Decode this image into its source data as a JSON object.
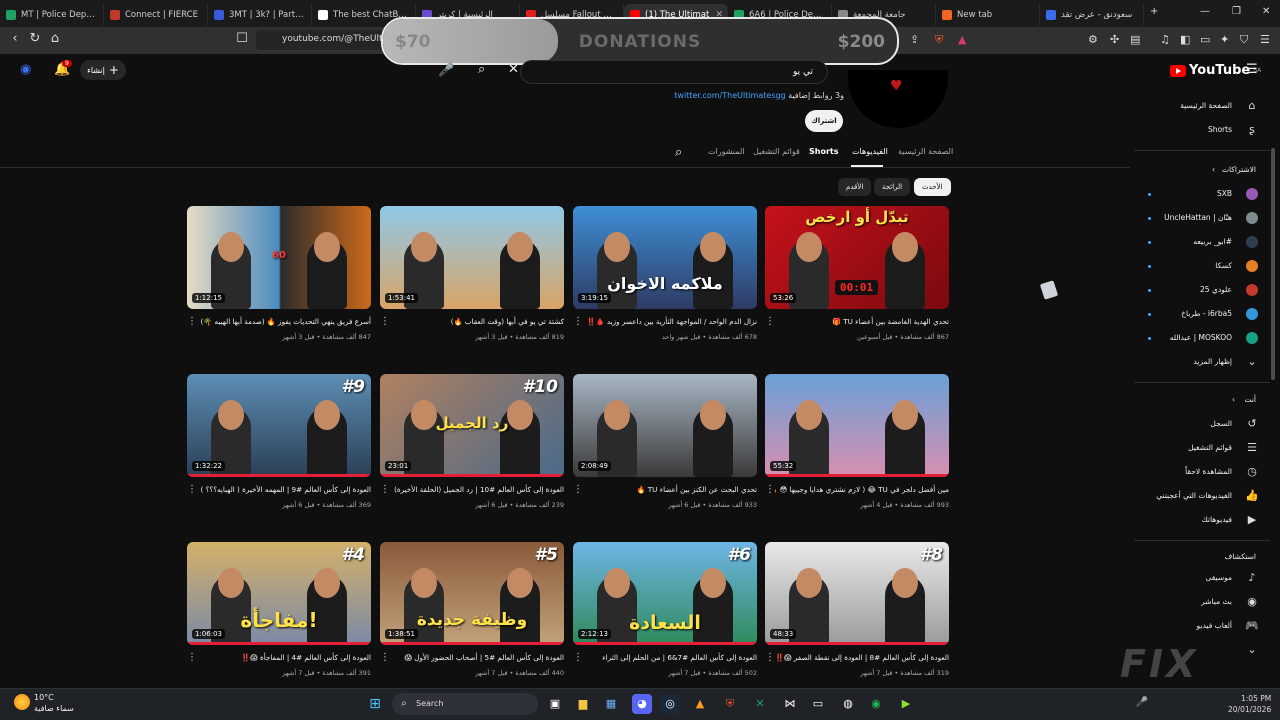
{
  "browser": {
    "tabs": [
      {
        "label": "MT | Police Departm",
        "color": "#1ea362"
      },
      {
        "label": "Connect | FIERCE",
        "color": "#c0392b"
      },
      {
        "label": "3MT | 3k? | Partner?",
        "color": "#3a5bd9"
      },
      {
        "label": "The best ChatBot a",
        "color": "#ffffff"
      },
      {
        "label": "الرئيسية | كريتر",
        "color": "#6a4cd3"
      },
      {
        "label": "مسلسل Fallout الموس",
        "color": "#e02020"
      },
      {
        "label": "(1) The Ultimat",
        "color": "#ff0000",
        "active": true
      },
      {
        "label": "6A6 | Police Depart",
        "color": "#1ea362"
      },
      {
        "label": "جامعة المجمعة",
        "color": "#888888"
      },
      {
        "label": "New tab",
        "color": "#f26522"
      },
      {
        "label": "سعودنق - عرض تقد",
        "color": "#3a6cf0"
      }
    ],
    "url": "youtube.com/@TheUltimateTU/videos",
    "url_prefix": "youtube.com/@TheUlti"
  },
  "donation": {
    "label": "DONATIONS",
    "min": "$70",
    "max": "$200",
    "progress": 0.34
  },
  "header": {
    "search_value": "تي يو",
    "create_label": "إنشاء",
    "logo_text": "YouTube",
    "logo_region": "SA",
    "notification_count": "9"
  },
  "channel": {
    "links_text": "twitter.com/TheUltimatesgg",
    "links_more": "و3 روابط إضافية",
    "subscribe_label": "اشتراك",
    "tabs": {
      "home": "الصفحة الرئيسية",
      "videos": "الفيديوهات",
      "shorts": "Shorts",
      "playlists": "قوائم التشغيل",
      "posts": "المنشورات"
    },
    "chips": {
      "latest": "الأحدث",
      "popular": "الرائجة",
      "oldest": "الأقدم"
    }
  },
  "videos": [
    {
      "title": "تحدي الهدية الغامضة بين أعضاء TU 🎁",
      "meta": "867 ألف مشاهدة • قبل أسبوعين",
      "duration": "53:26",
      "progress": 0.0
    },
    {
      "title": "نزال الدم الواحد / المواجهة الثأرية بين داعسر وزيد 🩸‼️",
      "meta": "678 ألف مشاهدة • قبل شهر واحد",
      "duration": "3:19:15",
      "progress": 0.0
    },
    {
      "title": "كشتة تي يو في أبها (وقت العقاب 🔥)",
      "meta": "819 ألف مشاهدة • قبل 3 أشهر",
      "duration": "1:53:41",
      "progress": 0.0
    },
    {
      "title": "أسرع فريق ينهي التحديات يفوز 🔥 (صدمة أبها الهيبه 🌴)",
      "meta": "847 ألف مشاهدة • قبل 3 أشهر",
      "duration": "1:12:15",
      "progress": 0.0
    },
    {
      "title": "مين أفضل دلجر في TU 😂 ( لازم نشتري هدايا وجيبها 😳 🔥)",
      "meta": "993 ألف مشاهدة • قبل 4 أشهر",
      "duration": "55:32",
      "progress": 1.0
    },
    {
      "title": "تحدي البحث عن الكنز بين أعضاء TU 🔥",
      "meta": "933 ألف مشاهدة • قبل 6 أشهر",
      "duration": "2:08:49",
      "progress": 0.0
    },
    {
      "title": "العودة إلى كأس العالم #10 | رد الجميل (الحلقة الأخيرة)",
      "meta": "239 ألف مشاهدة • قبل 6 أشهر",
      "duration": "23:01",
      "progress": 1.0
    },
    {
      "title": "العودة إلى كأس العالم #9 | المهمه الأخيرة ( الهبايه؟؟؟ )",
      "meta": "369 ألف مشاهدة • قبل 6 أشهر",
      "duration": "1:32:22",
      "progress": 1.0
    },
    {
      "title": "العودة إلى كأس العالم #8 | العودة إلى نقطة الصفر 😱‼️",
      "meta": "319 ألف مشاهدة • قبل 7 أشهر",
      "duration": "48:33",
      "progress": 1.0
    },
    {
      "title": "العودة إلى كأس العالم #7&6 | من الحلم إلى الثراء",
      "meta": "502 ألف مشاهدة • قبل 7 أشهر",
      "duration": "2:12:13",
      "progress": 1.0
    },
    {
      "title": "العودة إلى كأس العالم #5 | أصحاب الحضور الأول 😱",
      "meta": "440 ألف مشاهدة • قبل 7 أشهر",
      "duration": "1:38:51",
      "progress": 1.0
    },
    {
      "title": "العودة إلى كأس العالم #4 | المفاجأة 😱‼️",
      "meta": "391 ألف مشاهدة • قبل 7 أشهر",
      "duration": "1:06:03",
      "progress": 1.0
    }
  ],
  "thumbnail_text": {
    "v1": "تبدّل أو ارخص",
    "v1_timer": "00:01",
    "v2": "ملاكمه الاخوان",
    "v3": "",
    "v4": "60",
    "v7": "رد الجميل",
    "v7_ep": "#10",
    "v8_ep": "#9",
    "v9_ep": "#8",
    "v10": "السعادة",
    "v10_ep": "#6",
    "v11": "وظيفة جديدة",
    "v11_ep": "#5",
    "v12": "مفاجأة!",
    "v12_ep": "#4"
  },
  "sidebar": {
    "home": "الصفحة الرئيسية",
    "shorts": "Shorts",
    "subscriptions_head": "الاشتراكات",
    "subs": [
      {
        "name": "SXB",
        "color": "#9b59b6"
      },
      {
        "name": "UncleHattan | هتّان",
        "color": "#7f8c8d"
      },
      {
        "name": "ابو_ بربيعه#",
        "color": "#2c3e50"
      },
      {
        "name": "كسكا",
        "color": "#e67e22"
      },
      {
        "name": "علودي 25",
        "color": "#c0392b"
      },
      {
        "name": "طرباخ - i6rba5",
        "color": "#3498db"
      },
      {
        "name": "عبدالله | MOSKOO",
        "color": "#16a085"
      }
    ],
    "show_more": "إظهار المزيد",
    "you_head": "أنت",
    "you_items": [
      {
        "label": "السجل",
        "icon": "history-icon",
        "glyph": "↺"
      },
      {
        "label": "قوائم التشغيل",
        "icon": "playlists-icon",
        "glyph": "☰"
      },
      {
        "label": "المشاهدة لاحقاً",
        "icon": "watch-later-icon",
        "glyph": "◷"
      },
      {
        "label": "الفيديوهات التي أعجبتني",
        "icon": "like-icon",
        "glyph": "👍"
      },
      {
        "label": "فيديوهاتك",
        "icon": "your-videos-icon",
        "glyph": "▶"
      }
    ],
    "explore_head": "استكشاف",
    "explore_items": [
      {
        "label": "موسيقى",
        "icon": "music-icon",
        "glyph": "♪"
      },
      {
        "label": "بث مباشر",
        "icon": "live-icon",
        "glyph": "◉"
      },
      {
        "label": "ألعاب فيديو",
        "icon": "gaming-icon",
        "glyph": "🎮"
      },
      {
        "label": "",
        "icon": "more-icon",
        "glyph": "⌄"
      }
    ]
  },
  "taskbar": {
    "weather_temp": "10°C",
    "weather_desc": "سماء صافية",
    "search_label": "Search",
    "time": "1:05 PM",
    "date": "20/01/2026"
  },
  "watermark": "FIX"
}
